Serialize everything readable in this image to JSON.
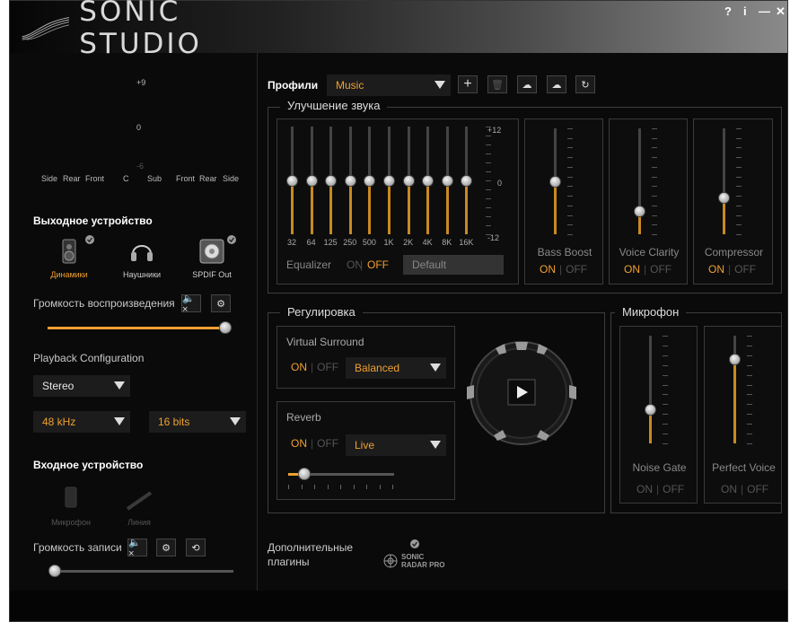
{
  "app": {
    "title": "SONIC STUDIO"
  },
  "titlebar": {
    "help": "?",
    "info": "i",
    "minimize": "—",
    "close": "✕"
  },
  "channel_meter": {
    "top": "+9",
    "mid": "0",
    "low": "-6",
    "labels": [
      "Side",
      "Rear",
      "Front",
      "C",
      "Sub",
      "Front",
      "Rear",
      "Side"
    ]
  },
  "output": {
    "title": "Выходное устройство",
    "devices": [
      {
        "label": "Динамики",
        "selected": true,
        "checked": true
      },
      {
        "label": "Наушники",
        "selected": false,
        "checked": false
      },
      {
        "label": "SPDIF Out",
        "selected": false,
        "checked": true
      }
    ],
    "volume_label": "Громкость воспроизведения",
    "volume_level": 0.97
  },
  "playback": {
    "label": "Playback Configuration",
    "config": "Stereo",
    "rate": "48 kHz",
    "bits": "16 bits"
  },
  "input": {
    "title": "Входное устройство",
    "devices": [
      {
        "label": "Микрофон"
      },
      {
        "label": "Линия"
      }
    ],
    "volume_label": "Громкость записи",
    "volume_level": 0.02
  },
  "profiles": {
    "label": "Профили",
    "value": "Music"
  },
  "enhancement": {
    "title": "Улучшение звука",
    "eq_scale": {
      "top": "+12",
      "mid": "0",
      "bottom": "-12"
    },
    "eq_bands": [
      "32",
      "64",
      "125",
      "250",
      "500",
      "1K",
      "2K",
      "4K",
      "8K",
      "16K"
    ],
    "eq_values": [
      0,
      0,
      0,
      0,
      0,
      0,
      0,
      0,
      0,
      0
    ],
    "equalizer_label": "Equalizer",
    "equalizer_on": "ON",
    "equalizer_off": "OFF",
    "equalizer_state": "OFF",
    "preset": "Default",
    "bass_boost": {
      "label": "Bass Boost",
      "on": "ON",
      "off": "OFF",
      "level": 0.5
    },
    "voice_clarity": {
      "label": "Voice Clarity",
      "on": "ON",
      "off": "OFF",
      "level": 0.22
    },
    "compressor": {
      "label": "Compressor",
      "on": "ON",
      "off": "OFF",
      "level": 0.35
    }
  },
  "regulation": {
    "title": "Регулировка",
    "virtual_surround": {
      "label": "Virtual Surround",
      "on": "ON",
      "off": "OFF",
      "mode": "Balanced"
    },
    "reverb": {
      "label": "Reverb",
      "on": "ON",
      "off": "OFF",
      "mode": "Live",
      "level": 0.15
    }
  },
  "microphone": {
    "title": "Микрофон",
    "noise_gate": {
      "label": "Noise Gate",
      "on": "ON",
      "off": "OFF",
      "level": 0.32
    },
    "perfect_voice": {
      "label": "Perfect Voice",
      "on": "ON",
      "off": "OFF",
      "level": 0.78
    }
  },
  "plugins": {
    "label_line1": "Дополнительные",
    "label_line2": "плагины",
    "radar_line1": "SONIC",
    "radar_line2": "RADAR PRO"
  },
  "colors": {
    "accent": "#f0a030",
    "bg": "#0a0a0a"
  }
}
